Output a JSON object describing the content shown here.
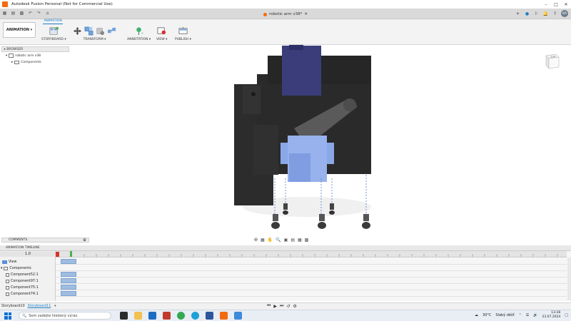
{
  "window": {
    "title": "Autodesk Fusion Personal (Not for Commercial Use)",
    "doc_tab": "robotic arm v38*",
    "user_initials": "KR"
  },
  "ribbon": {
    "workspace": "ANIMATION",
    "workspace_tab": "ANIMATION",
    "groups": [
      "STORYBOARD",
      "TRANSFORM",
      "ANNOTATION",
      "VIEW",
      "PUBLISH"
    ]
  },
  "browser": {
    "header": "BROWSER",
    "root": "robotic arm v38",
    "child": "Components"
  },
  "viewcube": {
    "face": "TOP"
  },
  "comments": {
    "label": "COMMENTS"
  },
  "timeline": {
    "header": "ANIMATION TIMELINE",
    "speed": "1.0",
    "rows": [
      {
        "label": "View"
      },
      {
        "label": "Components"
      },
      {
        "label": "Component52:1"
      },
      {
        "label": "Component97:1"
      },
      {
        "label": "Component75:1"
      },
      {
        "label": "Component74:1"
      }
    ],
    "ruler_ticks": [
      "1",
      "2",
      "3",
      "4",
      "5",
      "6",
      "7",
      "8",
      "9",
      "10",
      "11",
      "12",
      "13",
      "14",
      "15",
      "16",
      "17",
      "18",
      "19",
      "20",
      "21",
      "22",
      "23",
      "24",
      "25",
      "26",
      "27",
      "28",
      "29",
      "30",
      "31",
      "32",
      "33",
      "34",
      "35",
      "36",
      "37",
      "38",
      "39",
      "40"
    ]
  },
  "storyboards": {
    "items": [
      "Storyboard10",
      "Storyboard11"
    ],
    "add": "+"
  },
  "taskbar": {
    "search_placeholder": "Sem zadejte hledaný výraz.",
    "weather_temp": "30°C",
    "weather_text": "Slabý déšť",
    "time": "13:28",
    "date": "23.07.2024"
  },
  "colors": {
    "accent": "#1a7dc4",
    "part_dark": "#2a2a2a",
    "part_blue": "#8aa8e8"
  }
}
